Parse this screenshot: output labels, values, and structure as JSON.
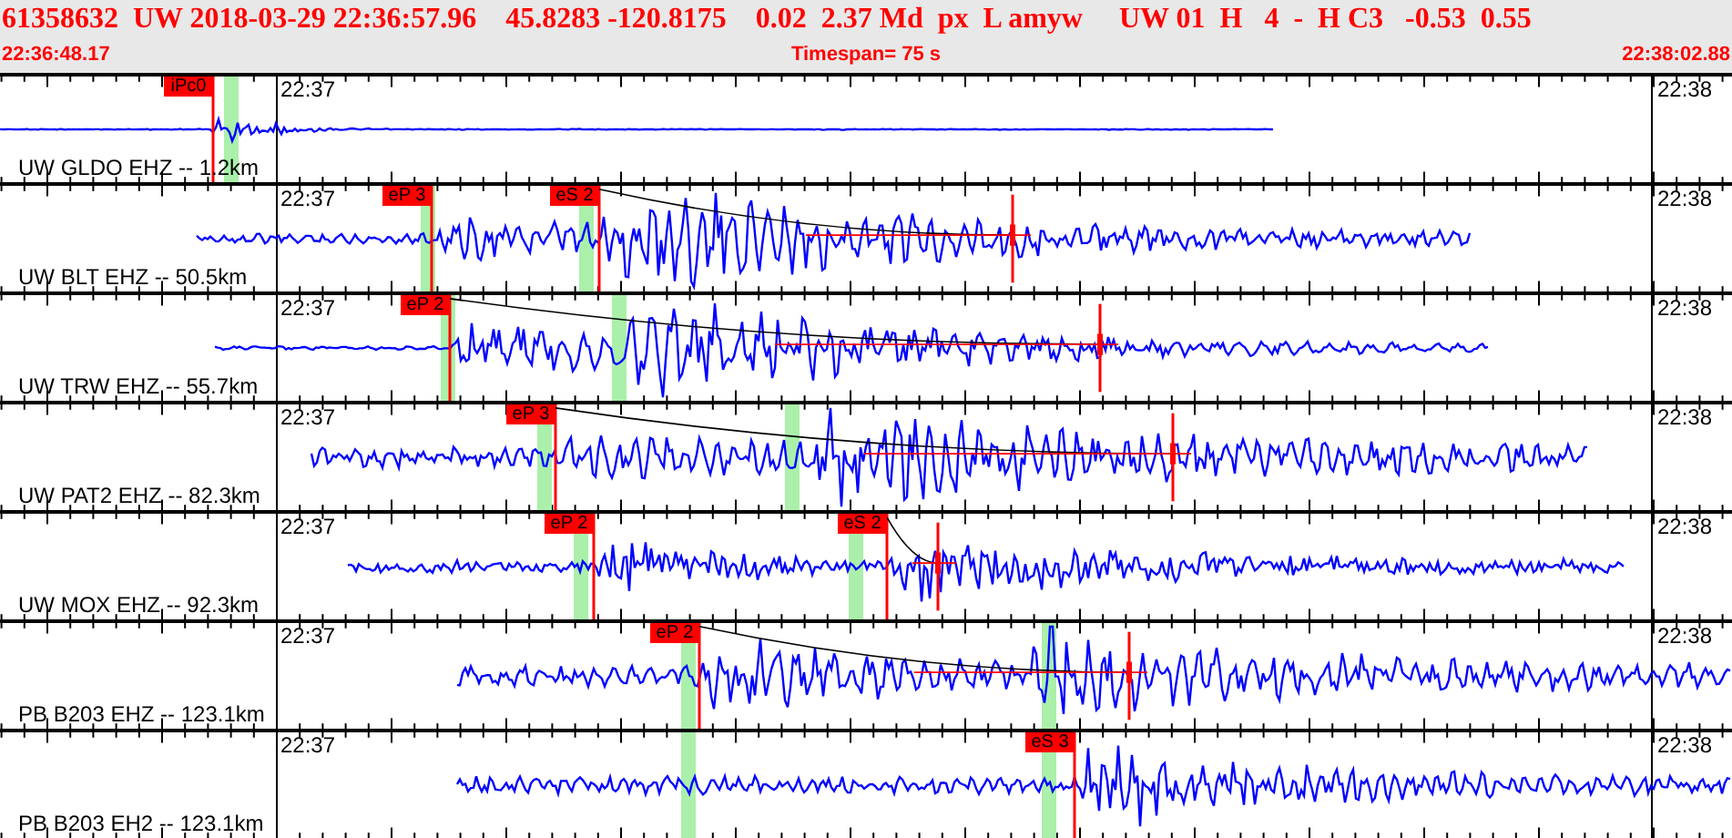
{
  "header": {
    "event_line": "61358632  UW 2018-03-29 22:36:57.96    45.8283 -120.8175    0.02  2.37 Md  px  L amyw     UW 01  H   4  -  H C3   -0.53  0.55",
    "start_time": "22:36:48.17",
    "timespan": "Timespan=  75 s",
    "end_time": "22:38:02.88"
  },
  "traces": [
    {
      "station": "UW GLDO EHZ -- 1.2km",
      "start_tick": "22:37",
      "end_tick": "22:38",
      "picks": [
        {
          "label": "iPc0"
        }
      ]
    },
    {
      "station": "UW BLT EHZ -- 50.5km",
      "start_tick": "22:37",
      "end_tick": "22:38",
      "picks": [
        {
          "label": "eP 3"
        },
        {
          "label": "eS 2"
        }
      ]
    },
    {
      "station": "UW TRW EHZ -- 55.7km",
      "start_tick": "22:37",
      "end_tick": "22:38",
      "picks": [
        {
          "label": "eP 2"
        }
      ]
    },
    {
      "station": "UW PAT2 EHZ -- 82.3km",
      "start_tick": "22:37",
      "end_tick": "22:38",
      "picks": [
        {
          "label": "eP 3"
        }
      ]
    },
    {
      "station": "UW MOX EHZ -- 92.3km",
      "start_tick": "22:37",
      "end_tick": "22:38",
      "picks": [
        {
          "label": "eP 2"
        },
        {
          "label": "eS 2"
        }
      ]
    },
    {
      "station": "PB B203 EHZ -- 123.1km",
      "start_tick": "22:37",
      "end_tick": "22:38",
      "picks": [
        {
          "label": "eP 2"
        }
      ]
    },
    {
      "station": "PB B203 EH2 -- 123.1km",
      "start_tick": "22:37",
      "end_tick": "22:38",
      "picks": [
        {
          "label": "eS 3"
        }
      ]
    }
  ]
}
